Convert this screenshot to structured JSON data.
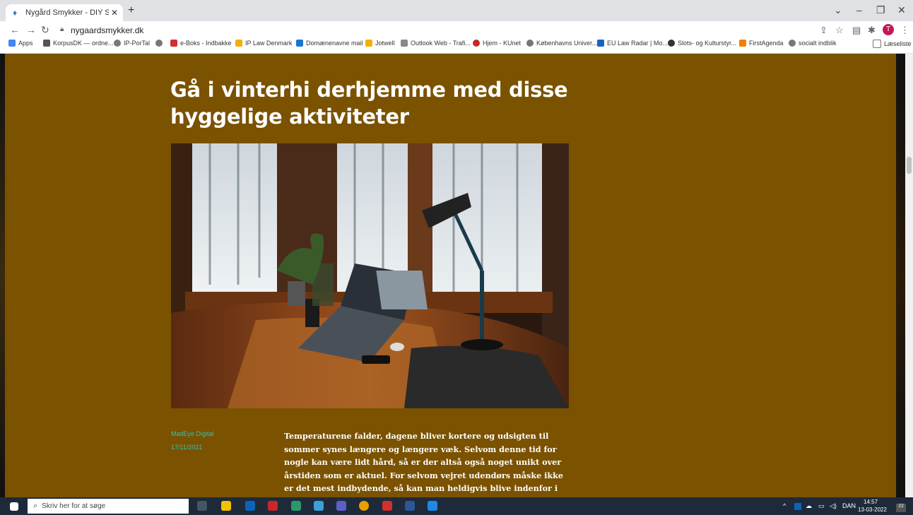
{
  "browser": {
    "tab_title": "Nygård Smykker - DIY Smykkein",
    "url": "nygaardsmykker.dk",
    "profile_initial": "T",
    "bookmarks": [
      "Apps",
      "KorpusDK — ordne...",
      "IP-PorTal",
      "e-Boks - Indbakke",
      "IP Law Denmark",
      "Domænenavne mail",
      "Jotwell",
      "Outlook Web - Trafi...",
      "Hjem - KUnet",
      "Københavns Univer...",
      "EU Law Radar | Mo...",
      "Slots- og Kulturstyr...",
      "FirstAgenda",
      "socialt indblik"
    ],
    "reading_list": "Læseliste"
  },
  "article": {
    "title": "Gå i vinterhi derhjemme med disse hyggelige aktiviteter",
    "author": "MadEye Digital",
    "date": "17/11/2021",
    "body": "Temperaturene falder, dagene bliver kortere og udsigten til sommer synes længere og længere væk. Selvom denne tid for nogle kan være lidt hård, så er der altså også noget unikt over årstiden som er aktuel. For selvom vejret udendørs måske ikke er det mest indbydende, så kan man heldigvis blive indenfor i varmen og hygge. Selvom man er mere indenfor end udenfor, så"
  },
  "taskbar": {
    "search_placeholder": "Skriv her for at søge",
    "language": "DAN",
    "time": "14:57",
    "date": "13-03-2022",
    "notifications": "22"
  }
}
